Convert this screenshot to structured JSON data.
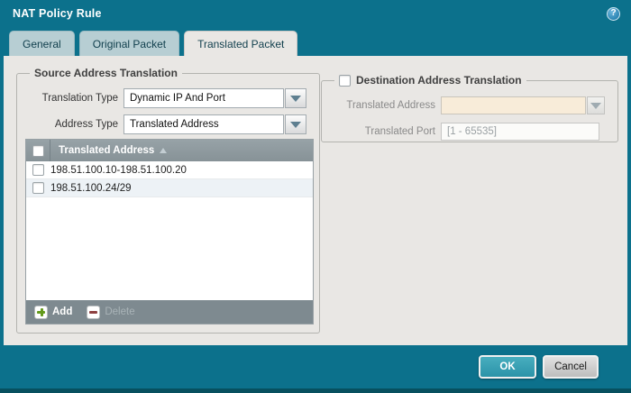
{
  "dialog": {
    "title": "NAT Policy Rule",
    "help_glyph": "?"
  },
  "tabs": [
    {
      "label": "General",
      "active": false
    },
    {
      "label": "Original Packet",
      "active": false
    },
    {
      "label": "Translated Packet",
      "active": true
    }
  ],
  "source": {
    "legend": "Source Address Translation",
    "translation_type": {
      "label": "Translation Type",
      "value": "Dynamic IP And Port"
    },
    "address_type": {
      "label": "Address Type",
      "value": "Translated Address"
    },
    "table": {
      "column_header": "Translated Address",
      "sort": "ascending",
      "rows": [
        "198.51.100.10-198.51.100.20",
        "198.51.100.24/29"
      ],
      "add_label": "Add",
      "delete_label": "Delete",
      "delete_enabled": false
    }
  },
  "destination": {
    "legend": "Destination Address Translation",
    "enabled": false,
    "translated_address": {
      "label": "Translated Address",
      "value": ""
    },
    "translated_port": {
      "label": "Translated Port",
      "placeholder": "[1 - 65535]"
    }
  },
  "footer": {
    "ok_label": "OK",
    "cancel_label": "Cancel"
  },
  "colors": {
    "frame_teal": "#0c718c",
    "frame_teal_dark": "#07505f",
    "tab_inactive": "#b7ced3",
    "tab_text": "#113f4d",
    "content_bg": "#e9e7e4",
    "table_header_gray": "#8f999e",
    "table_footer_gray": "#7e8a90",
    "row_alt": "#edf2f6",
    "add_green": "#649a1c",
    "delete_red": "#8e4040",
    "ok_button_teal": "#2f9cb1",
    "disabled_field_bg": "#f8ecd9"
  }
}
